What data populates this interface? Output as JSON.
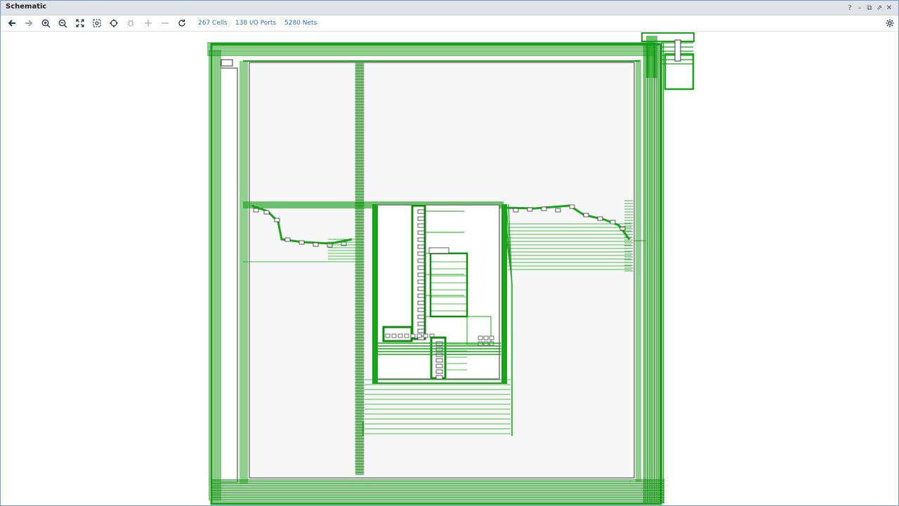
{
  "window": {
    "title": "Schematic",
    "controls": [
      {
        "name": "help-icon",
        "glyph": "?"
      },
      {
        "name": "minimize-icon",
        "glyph": "–"
      },
      {
        "name": "restore-icon",
        "glyph": "⧉"
      },
      {
        "name": "float-icon",
        "glyph": "⇗"
      },
      {
        "name": "close-icon",
        "glyph": "✕"
      }
    ]
  },
  "toolbar": {
    "buttons": [
      {
        "name": "back-button",
        "icon": "arrow-left-icon",
        "enabled": true
      },
      {
        "name": "forward-button",
        "icon": "arrow-right-icon",
        "enabled": false
      },
      {
        "name": "zoom-in-button",
        "icon": "zoom-in-icon",
        "enabled": true
      },
      {
        "name": "zoom-out-button",
        "icon": "zoom-out-icon",
        "enabled": true
      },
      {
        "name": "zoom-fit-button",
        "icon": "fit-icon",
        "enabled": true
      },
      {
        "name": "zoom-selection-button",
        "icon": "zoom-area-icon",
        "enabled": true
      },
      {
        "name": "crosshair-button",
        "icon": "crosshair-icon",
        "enabled": true
      },
      {
        "name": "expand-cone-button",
        "icon": "bug-icon",
        "enabled": false
      },
      {
        "name": "add-button",
        "icon": "plus-icon",
        "enabled": false
      },
      {
        "name": "remove-button",
        "icon": "minus-icon",
        "enabled": false
      },
      {
        "name": "refresh-button",
        "icon": "refresh-icon",
        "enabled": true
      }
    ],
    "cells": "267 Cells",
    "ports": "138 I/O Ports",
    "nets": "5280 Nets",
    "settings_icon": "gear-icon"
  },
  "colors": {
    "wire": "#1aa31a",
    "wire_dark": "#118a11",
    "module_fill": "#f7f7f7",
    "module_border": "#333333",
    "stat_link": "#2f6db0"
  }
}
